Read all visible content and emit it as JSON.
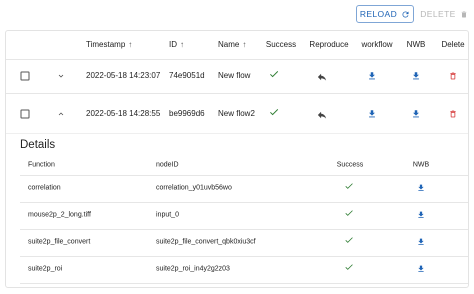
{
  "toolbar": {
    "reload_label": "RELOAD",
    "delete_label": "DELETE"
  },
  "table": {
    "headers": {
      "timestamp": "Timestamp",
      "id": "ID",
      "name": "Name",
      "success": "Success",
      "reproduce": "Reproduce",
      "workflow": "workflow",
      "nwb": "NWB",
      "delete": "Delete"
    },
    "rows": [
      {
        "timestamp": "2022-05-18 14:23:07",
        "id": "74e9051d",
        "name": "New flow",
        "success": "check",
        "expanded": false
      },
      {
        "timestamp": "2022-05-18 14:28:55",
        "id": "be9969d6",
        "name": "New flow2",
        "success": "check",
        "expanded": true
      }
    ]
  },
  "details": {
    "title": "Details",
    "headers": {
      "function": "Function",
      "node_id": "nodeID",
      "success": "Success",
      "nwb": "NWB"
    },
    "rows": [
      {
        "function": "correlation",
        "node_id": "correlation_y01uvb56wo"
      },
      {
        "function": "mouse2p_2_long.tiff",
        "node_id": "input_0"
      },
      {
        "function": "suite2p_file_convert",
        "node_id": "suite2p_file_convert_qbk0xiu3cf"
      },
      {
        "function": "suite2p_roi",
        "node_id": "suite2p_roi_in4y2g2z03"
      }
    ]
  },
  "colors": {
    "primary": "#1f64b6",
    "success": "#2e7d32",
    "danger": "#d32f2f",
    "disabled": "#b7b7b7",
    "border": "#e3e3e3"
  }
}
